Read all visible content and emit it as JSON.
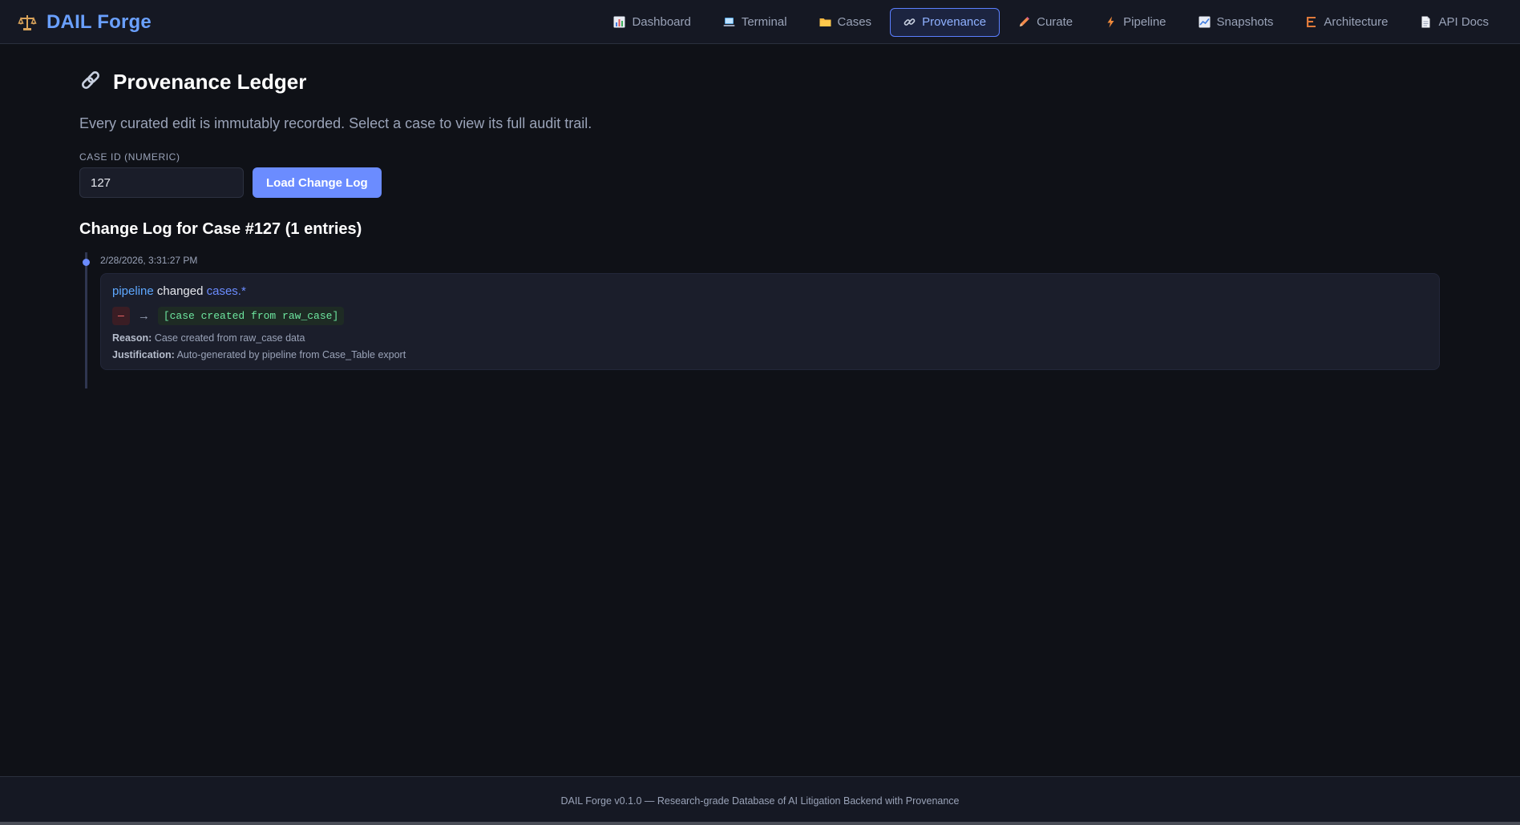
{
  "app": {
    "title": "DAIL Forge",
    "brand_icon": "scales-icon"
  },
  "nav": {
    "items": [
      {
        "label": "Dashboard",
        "icon": "bar-chart-icon",
        "active": false
      },
      {
        "label": "Terminal",
        "icon": "laptop-icon",
        "active": false
      },
      {
        "label": "Cases",
        "icon": "folder-icon",
        "active": false
      },
      {
        "label": "Provenance",
        "icon": "link-icon",
        "active": true
      },
      {
        "label": "Curate",
        "icon": "pencil-icon",
        "active": false
      },
      {
        "label": "Pipeline",
        "icon": "lightning-icon",
        "active": false
      },
      {
        "label": "Snapshots",
        "icon": "chart-icon",
        "active": false
      },
      {
        "label": "Architecture",
        "icon": "building-icon",
        "active": false
      },
      {
        "label": "API Docs",
        "icon": "document-icon",
        "active": false
      }
    ]
  },
  "page": {
    "title": "Provenance Ledger",
    "title_icon": "link-icon",
    "subtitle": "Every curated edit is immutably recorded. Select a case to view its full audit trail.",
    "field_label": "CASE ID (NUMERIC)",
    "case_input_value": "127",
    "load_button": "Load Change Log",
    "changelog_heading": "Change Log for Case #127 (1 entries)"
  },
  "entries": [
    {
      "timestamp": "2/28/2026, 3:31:27 PM",
      "actor": "pipeline",
      "verb": "changed",
      "field": "cases.*",
      "old_value": "—",
      "arrow": "→",
      "new_value": "[case created from raw_case]",
      "reason_label": "Reason:",
      "reason": "Case created from raw_case data",
      "justification_label": "Justification:",
      "justification": "Auto-generated by pipeline from Case_Table export"
    }
  ],
  "footer": {
    "text": "DAIL Forge v0.1.0 — Research-grade Database of AI Litigation Backend with Provenance"
  },
  "colors": {
    "accent": "#6b8cff",
    "background": "#0f1117",
    "card": "#1b1e2b"
  }
}
